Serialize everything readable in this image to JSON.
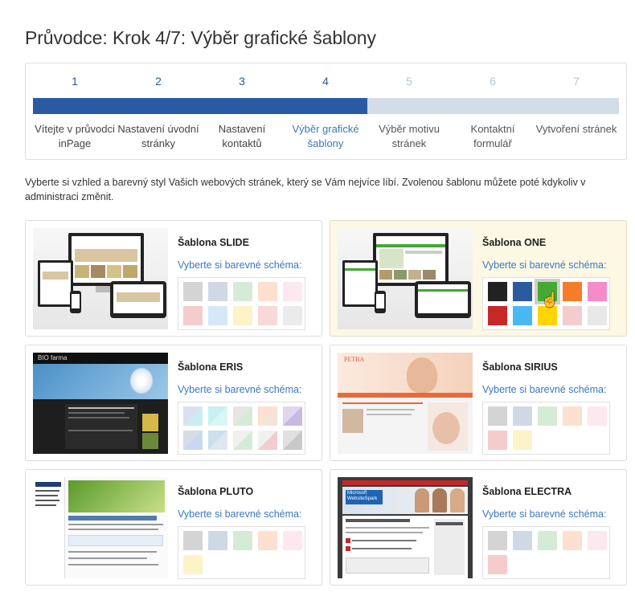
{
  "page": {
    "title": "Průvodce: Krok 4/7: Výběr grafické šablony",
    "intro": "Vyberte si vzhled a barevný styl Vašich webových stránek, který se Vám nejvíce líbí. Zvolenou šablonu můžete poté kdykoliv v administraci změnit."
  },
  "wizard": {
    "current_step": 4,
    "total_steps": 7,
    "progress_fraction": 0.571,
    "steps": [
      {
        "num": "1",
        "label": "Vítejte v průvodci inPage"
      },
      {
        "num": "2",
        "label": "Nastavení úvodní stránky"
      },
      {
        "num": "3",
        "label": "Nastavení kontaktů"
      },
      {
        "num": "4",
        "label": "Výběr grafické šablony"
      },
      {
        "num": "5",
        "label": "Výběr motivu stránek"
      },
      {
        "num": "6",
        "label": "Kontaktní formulář"
      },
      {
        "num": "7",
        "label": "Vytvoření stránek"
      }
    ]
  },
  "colors": {
    "accent": "#2a5aa0",
    "link": "#3a78c2",
    "selected_card_bg": "#fcf8e3"
  },
  "templates": [
    {
      "name": "Šablona SLIDE",
      "scheme_label": "Vyberte si barevné schéma:",
      "selected": false,
      "swatches": [
        "#d4d4d4",
        "#cfd9e6",
        "#d6ebd6",
        "#fde0d0",
        "#fde8f0",
        "#f4cccc",
        "#d6e8f6",
        "#fdf3c8",
        "#f8d8d8",
        "#ebebeb"
      ]
    },
    {
      "name": "Šablona ONE",
      "scheme_label": "Vyberte si barevné schéma:",
      "selected": true,
      "selected_swatch": 2,
      "swatches": [
        "#222222",
        "#2a5aa0",
        "#44a832",
        "#f57c2a",
        "#f58cc8",
        "#c62828",
        "#4ab8f0",
        "#ffd400",
        "#f4cccc",
        "#e8e8e8"
      ]
    },
    {
      "name": "Šablona ERIS",
      "scheme_label": "Vyberte si barevné schéma:",
      "selected": false,
      "swatches": [
        [
          "#dcdff0",
          "#c8eef0"
        ],
        [
          "#c8f0f0",
          "#d8f6f6"
        ],
        [
          "#e6e6e6",
          "#d6ebd6"
        ],
        [
          "#fde0d0",
          "#f4e4d8"
        ],
        [
          "#e0d6f0",
          "#c8b8e6"
        ],
        [
          "#d6dce6",
          "#c8d8f0"
        ],
        [
          "#c8e0f0",
          "#e0e6ee"
        ],
        [
          "#f0f0f0",
          "#d6ebd6"
        ],
        [
          "#f0f0f0",
          "#f4cccc"
        ],
        [
          "#e0e0e0",
          "#c8c8c8"
        ]
      ]
    },
    {
      "name": "Šablona SIRIUS",
      "scheme_label": "Vyberte si barevné schéma:",
      "selected": false,
      "swatches": [
        "#d4d4d4",
        "#cfd9e6",
        "#d6ebd6",
        "#fde0d0",
        "#fde8f0",
        "#f4cccc",
        "#fdf3c8"
      ]
    },
    {
      "name": "Šablona PLUTO",
      "scheme_label": "Vyberte si barevné schéma:",
      "selected": false,
      "swatches": [
        "#d4d4d4",
        "#cfd9e6",
        "#d6ebd6",
        "#fde0d0",
        "#fde8f0",
        "#fdf3c8"
      ]
    },
    {
      "name": "Šablona ELECTRA",
      "scheme_label": "Vyberte si barevné schéma:",
      "selected": false,
      "swatches": [
        "#d4d4d4",
        "#cfd9e6",
        "#d6ebd6",
        "#fde0d0",
        "#fde8f0",
        "#f4cccc"
      ]
    }
  ],
  "thumbnails": {
    "eris_brand": "BIO farma",
    "sirius_brand": "PETRA",
    "electra_brand": "Microsoft WebsiteSpark",
    "electra_heading": "Microsoft WebsiteSpark",
    "pluto_heading": "Atraktivní a jejich podrobnější svět"
  },
  "icons": {
    "pointer": "hand-pointer-icon"
  }
}
